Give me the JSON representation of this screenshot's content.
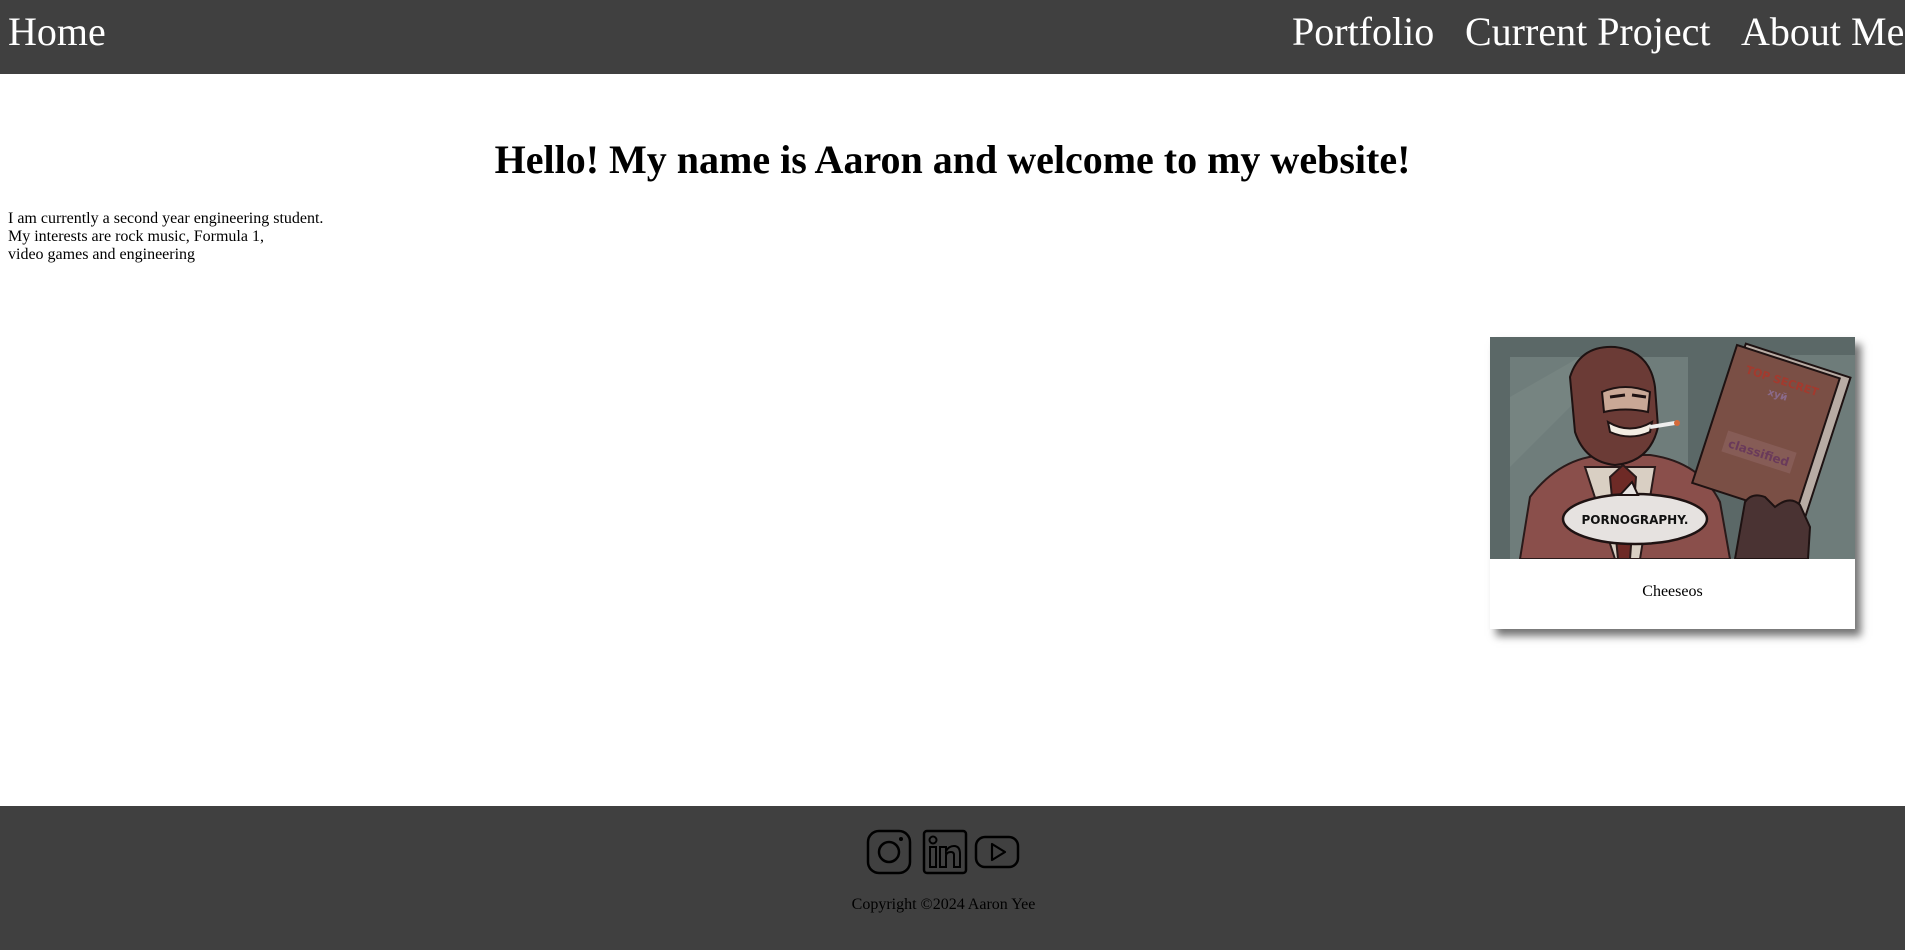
{
  "nav": {
    "home": "Home",
    "portfolio": "Portfolio",
    "current_project": "Current Project",
    "about": "About Me"
  },
  "main": {
    "title": "Hello! My name is Aaron and welcome to my website!",
    "intro_lines": [
      "I am currently a second year engineering student.",
      "My interests are rock music, Formula 1,",
      "video games and engineering"
    ]
  },
  "card": {
    "image": {
      "speech_bubble": "PORNOGRAPHY.",
      "folder_stamp": "classified"
    },
    "caption": "Cheeseos"
  },
  "footer": {
    "social": [
      {
        "name": "instagram-icon"
      },
      {
        "name": "linkedin-icon"
      },
      {
        "name": "youtube-icon"
      }
    ],
    "copyright": "Copyright ©2024 Aaron Yee"
  },
  "colors": {
    "header_bg": "#404040",
    "footer_bg": "#404040",
    "nav_text": "#ffffff",
    "page_bg": "#ffffff"
  }
}
